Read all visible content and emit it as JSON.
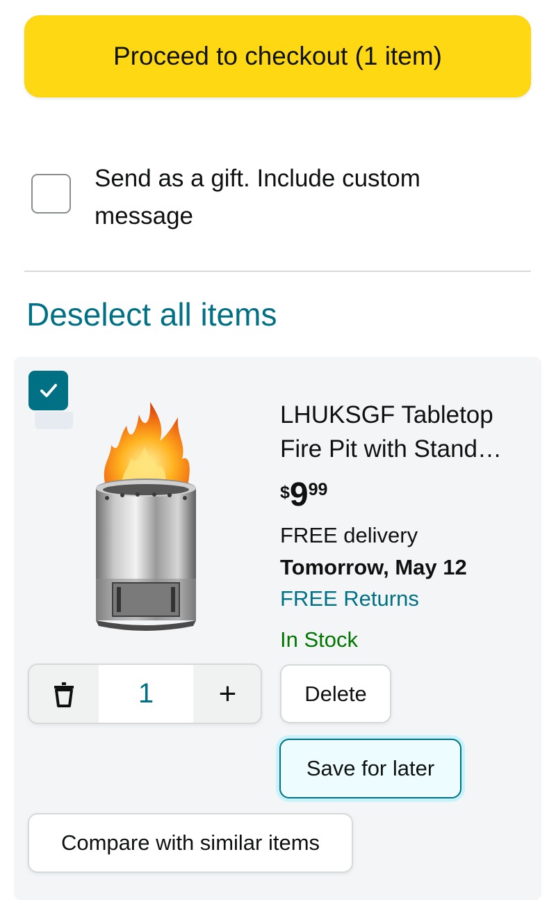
{
  "checkout": {
    "label": "Proceed to checkout (1 item)"
  },
  "gift": {
    "label": "Send as a gift. Include custom message",
    "checked": false
  },
  "deselect": {
    "label": "Deselect all items"
  },
  "item": {
    "checked": true,
    "title_line1": "LHUKSGF Tabletop",
    "title_line2": "Fire Pit with Stand…",
    "price": {
      "symbol": "$",
      "whole": "9",
      "fraction": "99"
    },
    "delivery": "FREE delivery",
    "delivery_date": "Tomorrow, May 12",
    "returns": "FREE Returns",
    "stock": "In Stock",
    "quantity": "1",
    "plus_label": "+",
    "delete_label": "Delete",
    "save_label": "Save for later",
    "compare_label": "Compare with similar items"
  },
  "colors": {
    "checkout_button": "#ffd814",
    "link": "#007185",
    "in_stock": "#007600",
    "checkbox_checked": "#007185"
  },
  "icons": {
    "trash": "trash-icon",
    "check": "checkmark-icon",
    "product": "fire-pit-image"
  }
}
